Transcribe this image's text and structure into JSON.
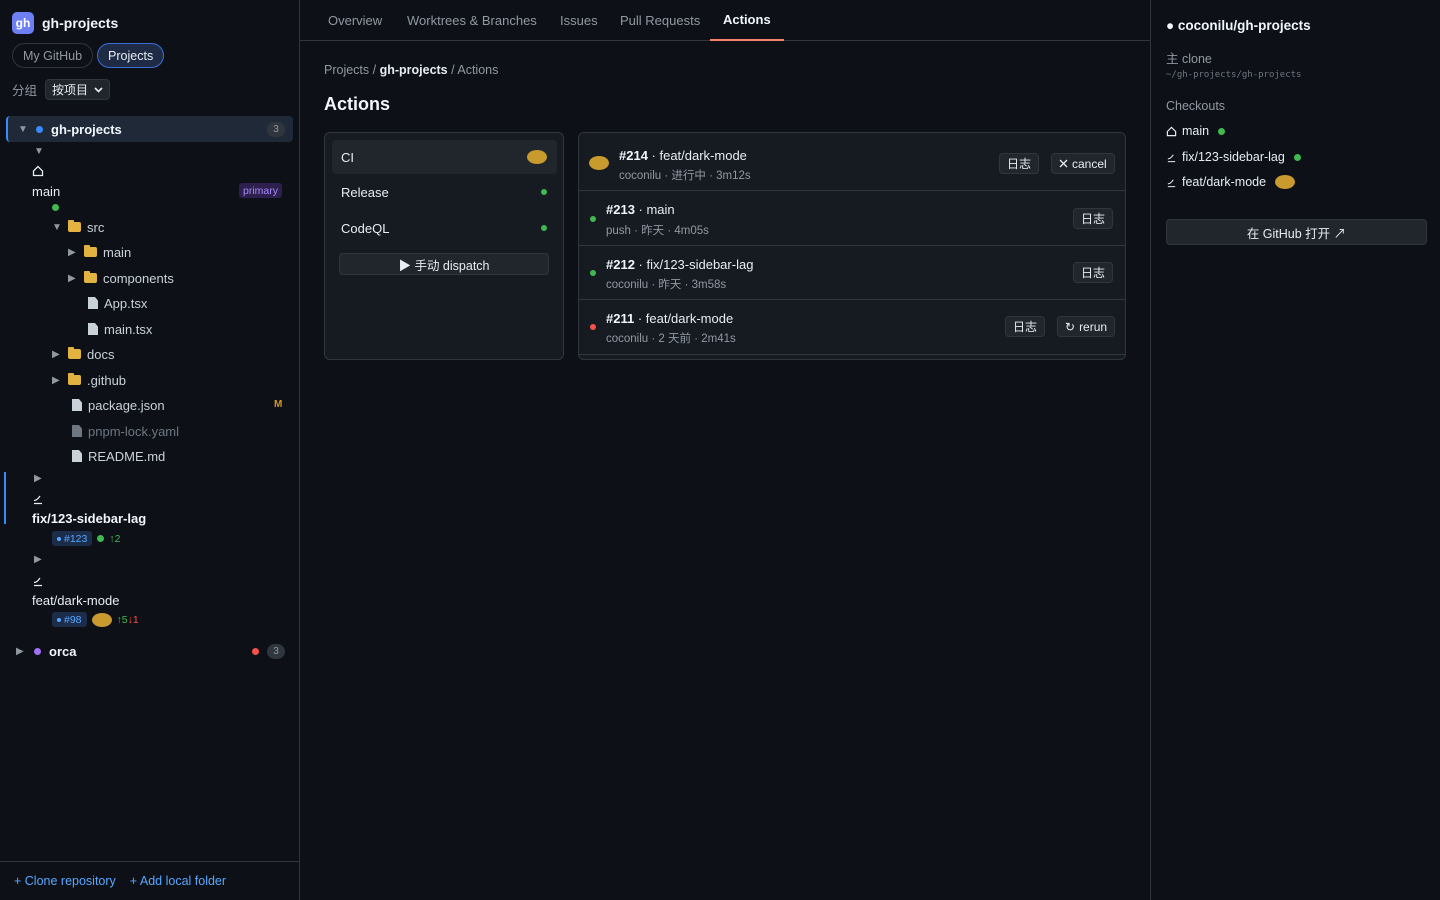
{
  "app": {
    "logo": "gh",
    "title": "gh-projects"
  },
  "mode_tabs": [
    {
      "label": "My GitHub",
      "active": false
    },
    {
      "label": "Projects",
      "active": true
    }
  ],
  "group": {
    "label": "分组",
    "value": "按项目"
  },
  "projects": [
    {
      "name": "gh-projects",
      "count": "3",
      "color": "#388bfd",
      "expanded": true
    },
    {
      "name": "orca",
      "count": "3",
      "color": "#a371f7",
      "status_color": "#f85149",
      "expanded": false
    }
  ],
  "worktrees": {
    "main": {
      "name": "main",
      "badge": "primary",
      "icon": "home-icon",
      "status_color": "#3fb950"
    },
    "fix": {
      "name": "fix/123-sidebar-lag",
      "pr": "#123",
      "ahead": "↑2",
      "status_color": "#3fb950",
      "icon": "branch-icon"
    },
    "feat": {
      "name": "feat/dark-mode",
      "pr": "#98",
      "ahead": "↑5",
      "behind": "↓1",
      "icon": "branch-icon"
    }
  },
  "file_tree": [
    {
      "name": "src",
      "type": "folder",
      "expanded": true
    },
    {
      "name": "main",
      "type": "folder"
    },
    {
      "name": "components",
      "type": "folder"
    },
    {
      "name": "App.tsx",
      "type": "file"
    },
    {
      "name": "main.tsx",
      "type": "file"
    },
    {
      "name": "docs",
      "type": "folder"
    },
    {
      "name": ".github",
      "type": "folder"
    },
    {
      "name": "package.json",
      "type": "file",
      "status": "M"
    },
    {
      "name": "pnpm-lock.yaml",
      "type": "file",
      "ignored": true
    },
    {
      "name": "README.md",
      "type": "file"
    }
  ],
  "sidebar_footer": {
    "clone": "+ Clone repository",
    "add_folder": "+ Add local folder"
  },
  "tabs": [
    {
      "label": "Overview"
    },
    {
      "label": "Worktrees & Branches"
    },
    {
      "label": "Issues"
    },
    {
      "label": "Pull Requests"
    },
    {
      "label": "Actions",
      "active": true
    }
  ],
  "breadcrumb": {
    "root": "Projects",
    "sep": " / ",
    "project": "gh-projects",
    "page": "Actions"
  },
  "page_title": "Actions",
  "workflows": [
    {
      "name": "CI",
      "status": "running",
      "active": true
    },
    {
      "name": "Release",
      "status": "success"
    },
    {
      "name": "CodeQL",
      "status": "success"
    }
  ],
  "dispatch_label": "▶ 手动 dispatch",
  "runs": [
    {
      "id": "#214",
      "title": " · feat/dark-mode",
      "meta": "coconilu · 进行中 · 3m12s",
      "status": "running",
      "log": "日志",
      "action": "cancel",
      "action_icon": "x-icon"
    },
    {
      "id": "#213",
      "title": " · main",
      "meta": "push · 昨天 · 4m05s",
      "status": "success",
      "log": "日志"
    },
    {
      "id": "#212",
      "title": " · fix/123-sidebar-lag",
      "meta": "coconilu · 昨天 · 3m58s",
      "status": "success",
      "log": "日志"
    },
    {
      "id": "#211",
      "title": " · feat/dark-mode",
      "meta": "coconilu · 2 天前 · 2m41s",
      "status": "failure",
      "log": "日志",
      "action": "rerun",
      "action_icon": "↻"
    }
  ],
  "colors": {
    "success": "#3fb950",
    "failure": "#f85149",
    "running": "#c99a2e",
    "accent": "#388bfd",
    "tab_underline": "#f78166"
  },
  "right_panel": {
    "repo": "● coconilu/gh-projects",
    "clone_label": "主 clone",
    "clone_path": "~/gh-projects/gh-projects",
    "checkouts_label": "Checkouts",
    "checkouts": [
      {
        "name": "main",
        "icon": "home-icon",
        "status": "success"
      },
      {
        "name": "fix/123-sidebar-lag",
        "icon": "branch-icon",
        "status": "success"
      },
      {
        "name": "feat/dark-mode",
        "icon": "branch-icon",
        "status": "running"
      }
    ],
    "open_github": "在 GitHub 打开 ↗"
  }
}
